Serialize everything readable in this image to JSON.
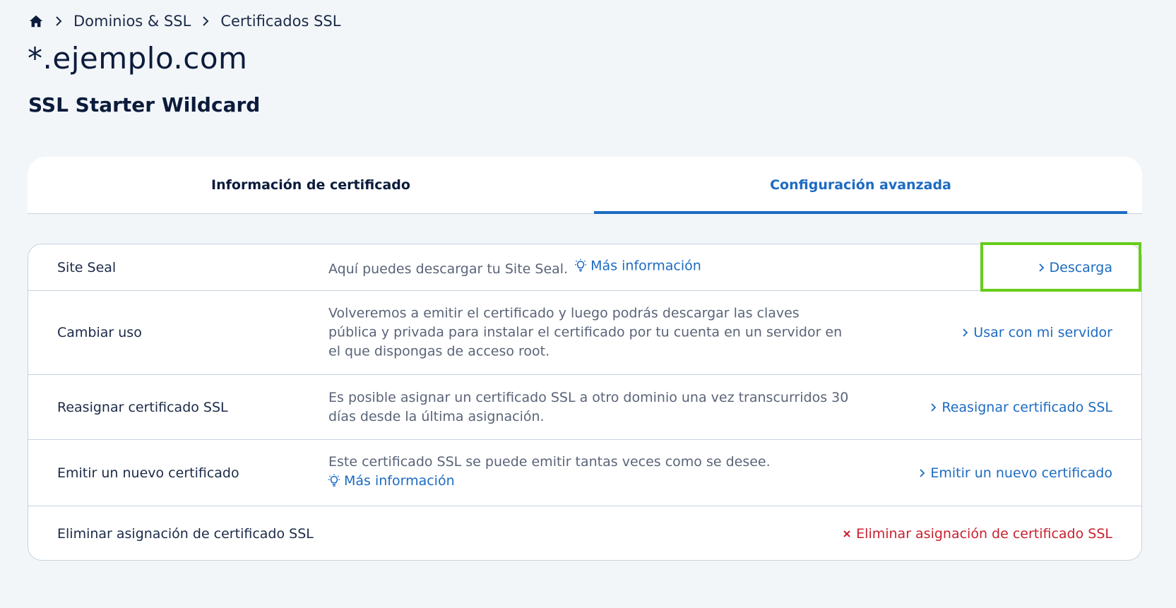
{
  "breadcrumb": {
    "items": [
      "Dominios & SSL",
      "Certificados SSL"
    ]
  },
  "page": {
    "title": "*.ejemplo.com",
    "subtitle": "SSL Starter Wildcard"
  },
  "tabs": [
    {
      "label": "Información de certificado",
      "active": false
    },
    {
      "label": "Configuración avanzada",
      "active": true
    }
  ],
  "rows": [
    {
      "label": "Site Seal",
      "desc": "Aquí puedes descargar tu Site Seal.",
      "info_link": "Más información",
      "action": "Descarga"
    },
    {
      "label": "Cambiar uso",
      "desc": "Volveremos a emitir el certificado y luego podrás descargar las claves pública y privada para instalar el certificado por tu cuenta en un servidor en el que dispongas de acceso root.",
      "action": "Usar con mi servidor"
    },
    {
      "label": "Reasignar certificado SSL",
      "desc": "Es posible asignar un certificado SSL a otro dominio una vez transcurridos 30 días desde la última asignación.",
      "action": "Reasignar certificado SSL"
    },
    {
      "label": "Emitir un nuevo certificado",
      "desc": "Este certificado SSL se puede emitir tantas veces como se desee.",
      "info_link": "Más información",
      "action": "Emitir un nuevo certificado"
    },
    {
      "label": "Eliminar asignación de certificado SSL",
      "action": "Eliminar asignación de certificado SSL"
    }
  ],
  "colors": {
    "accent": "#1c6bc2",
    "danger": "#c8202e",
    "highlight": "#66cc1a",
    "background": "#f3f6f9"
  }
}
